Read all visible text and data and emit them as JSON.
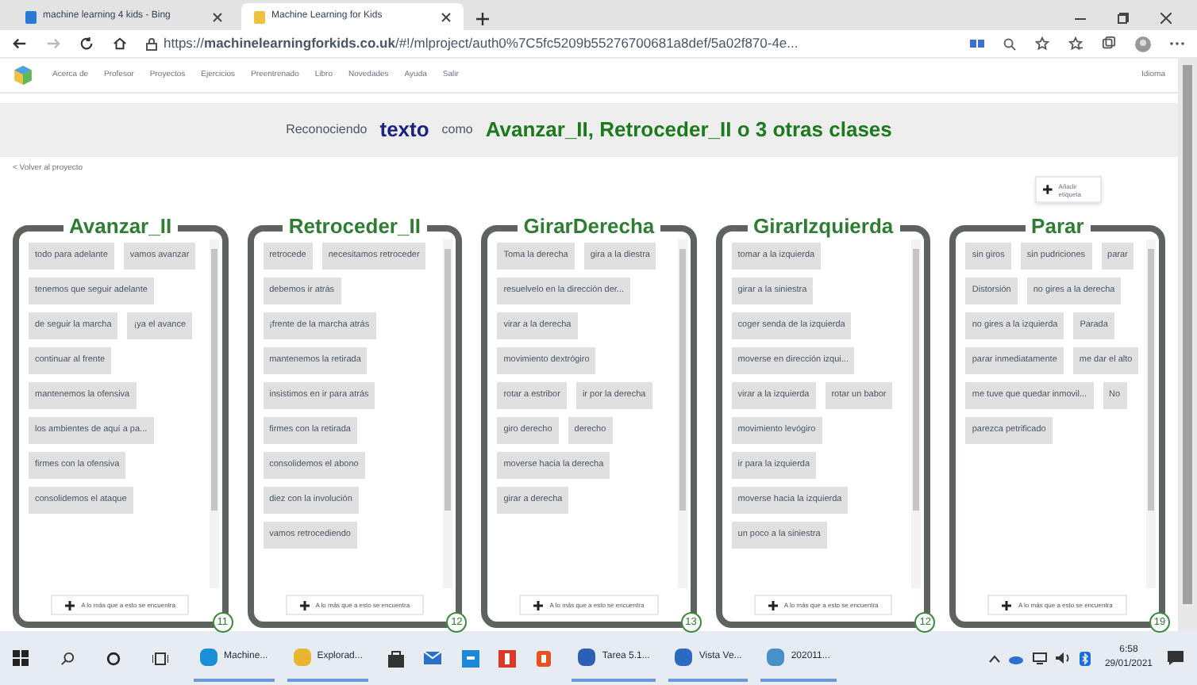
{
  "browser": {
    "tabs": [
      {
        "label": "machine learning 4 kids - Bing",
        "selected": false
      },
      {
        "label": "Machine Learning for Kids",
        "selected": true
      }
    ],
    "url": "https://**machinelearningforkids.co.uk**/#!/mlproject/auth0%7C5fc5209b55276700681a8def/5a02f870-4e..."
  },
  "nav": {
    "items": [
      "Acerca de",
      "Profesor",
      "Proyectos",
      "Ejercicios",
      "Preentrenado",
      "Libro",
      "Novedades",
      "Ayuda",
      "Salir"
    ],
    "language": "Idioma"
  },
  "heading": {
    "prefix": "Reconociendo",
    "type": "texto",
    "middle": "como",
    "classes": "Avanzar_II, Retroceder_II o 3 otras clases"
  },
  "back_link": "< Volver al proyecto",
  "add_label_button": "Añadir etiqueta",
  "columns": [
    {
      "title": "Avanzar_II",
      "count": "11",
      "add_button": "A lo más que a esto se encuentra",
      "examples": [
        "todo para adelante",
        "vamos avanzar",
        "tenemos que seguir adelante",
        "de seguir la marcha",
        "¡ya el avance",
        "continuar al frente",
        "mantenemos la ofensiva",
        "los ambientes de aquí a pa...",
        "firmes con la ofensiva",
        "consolidemos el ataque"
      ]
    },
    {
      "title": "Retroceder_II",
      "count": "12",
      "add_button": "A lo más que a esto se encuentra",
      "examples": [
        "retrocede",
        "necesitamos retroceder",
        "debemos ir atrás",
        "¡frente de la marcha atrás",
        "mantenemos la retirada",
        "insistimos en ir para atrás",
        "firmes con la retirada",
        "consolidemos el abono",
        "diez con la involución",
        "vamos retrocediendo"
      ]
    },
    {
      "title": "GirarDerecha",
      "count": "13",
      "add_button": "A lo más que a esto se encuentra",
      "examples": [
        "Toma la derecha",
        "gira a la diestra",
        "resuelvelo en la dirección der...",
        "virar a la derecha",
        "movimiento dextrógiro",
        "rotar a estribor",
        "ir por la derecha",
        "giro derecho",
        "derecho",
        "moverse hacia la derecha",
        "girar a derecha"
      ]
    },
    {
      "title": "GirarIzquierda",
      "count": "12",
      "add_button": "A lo más que a esto se encuentra",
      "examples": [
        "tomar a la izquierda",
        "girar a la siniestra",
        "coger senda de la izquierda",
        "moverse en dirección izqui...",
        "virar a la izquierda",
        "rotar un babor",
        "movimiento levógiro",
        "ir para la izquierda",
        "moverse hacia la izquierda",
        "un poco a la siniestra"
      ]
    },
    {
      "title": "Parar",
      "count": "19",
      "add_button": "A lo más que a esto se encuentra",
      "examples": [
        "sin giros",
        "sin pudriciones",
        "parar",
        "Distorsión",
        "no gires a la derecha",
        "no gires a la izquierda",
        "Parada",
        "parar inmediatamente",
        "me dar el alto",
        "me tuve que quedar inmovil...",
        "No",
        "parezca petrificado"
      ]
    }
  ],
  "taskbar": {
    "apps": [
      {
        "label": "Machine...",
        "kind": "browser"
      },
      {
        "label": "Explorad...",
        "kind": "folder"
      },
      {
        "label": "Tarea 5.1...",
        "kind": "doc"
      },
      {
        "label": "Vista Ve...",
        "kind": "image"
      },
      {
        "label": "202011...",
        "kind": "file"
      }
    ],
    "time": "6:58",
    "date": "29/01/2021"
  }
}
